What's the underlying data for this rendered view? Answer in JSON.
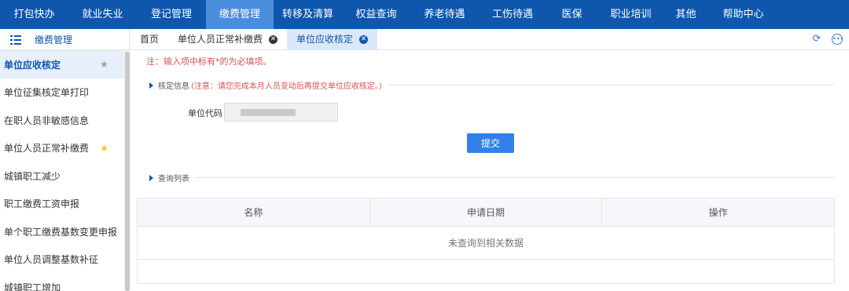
{
  "topnav": {
    "items": [
      {
        "label": "打包快办",
        "active": false
      },
      {
        "label": "就业失业",
        "active": false
      },
      {
        "label": "登记管理",
        "active": false
      },
      {
        "label": "缴费管理",
        "active": true
      },
      {
        "label": "转移及清算",
        "active": false
      },
      {
        "label": "权益查询",
        "active": false
      },
      {
        "label": "养老待遇",
        "active": false
      },
      {
        "label": "工伤待遇",
        "active": false
      },
      {
        "label": "医保",
        "active": false
      },
      {
        "label": "职业培训",
        "active": false
      },
      {
        "label": "其他",
        "active": false
      },
      {
        "label": "帮助中心",
        "active": false
      }
    ],
    "active_color": "#4b8ddd",
    "bar_color": "#0e57ad"
  },
  "menu": {
    "title": "缴费管理",
    "icon": "list-icon"
  },
  "tabs": [
    {
      "label": "首页",
      "closable": false,
      "active": false
    },
    {
      "label": "单位人员正常补缴费",
      "closable": true,
      "active": false
    },
    {
      "label": "单位应收核定",
      "closable": true,
      "active": true
    }
  ],
  "toolbar_icons": [
    "refresh-icon",
    "more-icon"
  ],
  "sidebar": {
    "items": [
      {
        "label": "单位应收核定",
        "active": true,
        "star": "grey"
      },
      {
        "label": "单位征集核定单打印",
        "active": false,
        "star": ""
      },
      {
        "label": "在职人员非敏感信息",
        "active": false,
        "star": ""
      },
      {
        "label": "单位人员正常补缴费",
        "active": false,
        "star": "yellow"
      },
      {
        "label": "城镇职工减少",
        "active": false,
        "star": ""
      },
      {
        "label": "职工缴费工资申报",
        "active": false,
        "star": ""
      },
      {
        "label": "单个职工缴费基数变更申报",
        "active": false,
        "star": ""
      },
      {
        "label": "单位人员调整基数补征",
        "active": false,
        "star": ""
      },
      {
        "label": "城镇职工增加",
        "active": false,
        "star": ""
      }
    ]
  },
  "main": {
    "notice": "注：输入项中标有*的为必填项。",
    "section1": {
      "title": "核定信息",
      "warning": "(注意：请您完成本月人员变动后再提交单位应收核定。)"
    },
    "unit_code": {
      "label": "单位代码",
      "value": ""
    },
    "submit_label": "提交",
    "section2": {
      "title": "查询列表"
    },
    "table": {
      "columns": [
        "名称",
        "申请日期",
        "操作"
      ],
      "empty_text": "未查询到相关数据"
    }
  },
  "colors": {
    "accent": "#3381e8",
    "warning": "#d9534f",
    "star_yellow": "#f5c518",
    "star_grey": "#a0a0a0"
  }
}
